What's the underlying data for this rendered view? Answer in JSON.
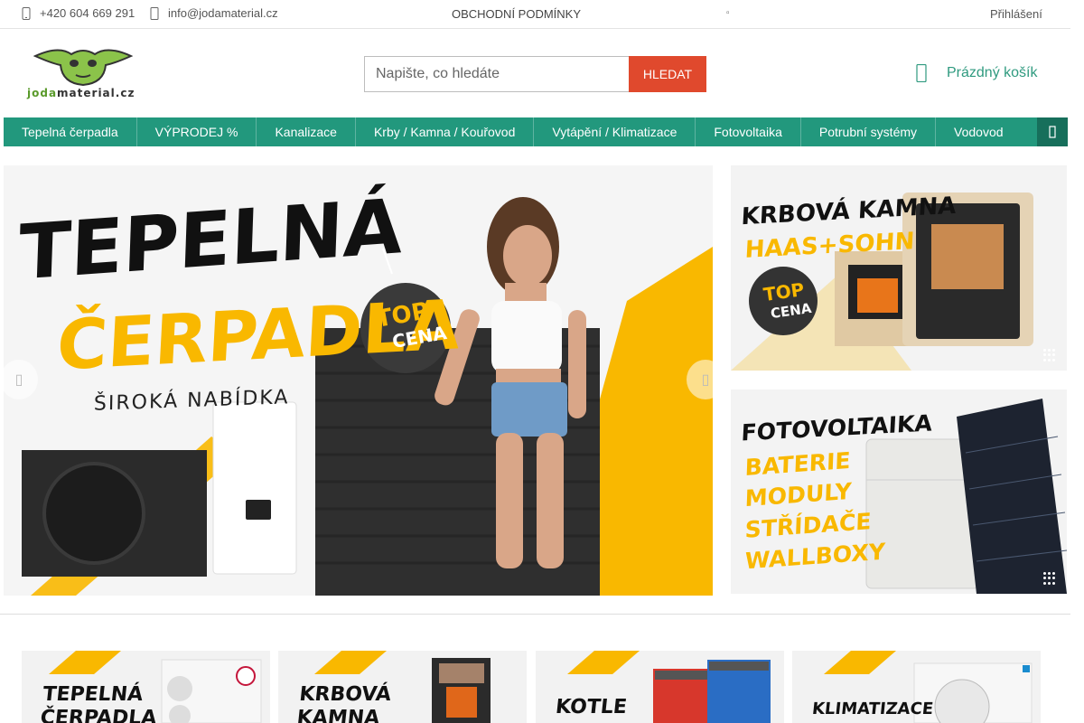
{
  "topbar": {
    "phone": "+420 604 669 291",
    "email": "info@jodamaterial.cz",
    "terms": "OBCHODNÍ PODMÍNKY",
    "login": "Přihlášení"
  },
  "logo": {
    "part1": "joda",
    "part2": "material.cz"
  },
  "search": {
    "placeholder": "Napište, co hledáte",
    "button": "HLEDAT"
  },
  "cart": {
    "label": "Prázdný košík"
  },
  "nav": {
    "items": [
      "Tepelná čerpadla",
      "VÝPRODEJ %",
      "Kanalizace",
      "Krby / Kamna / Kouřovod",
      "Vytápění / Klimatizace",
      "Fotovoltaika",
      "Potrubní systémy",
      "Vodovod"
    ]
  },
  "hero": {
    "title1": "TEPELNÁ",
    "title2": "ČERPADLA",
    "subtitle": "ŠIROKÁ NABÍDKA",
    "badge1": "TOP",
    "badge2": "CENA"
  },
  "banner1": {
    "line1": "KRBOVÁ KAMNA",
    "line2": "HAAS+SOHN",
    "badge1": "TOP",
    "badge2": "CENA"
  },
  "banner2": {
    "title": "FOTOVOLTAIKA",
    "l1": "BATERIE",
    "l2": "MODULY",
    "l3": "STŘÍDAČE",
    "l4": "WALLBOXY"
  },
  "categories": [
    {
      "label1": "TEPELNÁ",
      "label2": "ČERPADLA"
    },
    {
      "label1": "KRBOVÁ",
      "label2": "KAMNA"
    },
    {
      "label1": "KOTLE",
      "label2": ""
    },
    {
      "label1": "KLIMATIZACE",
      "label2": ""
    }
  ],
  "colors": {
    "accent": "#22987d",
    "search_button": "#e0492d",
    "highlight": "#f9b800"
  },
  "icons": {
    "phone": "phone-icon",
    "email": "email-icon",
    "cart": "cart-icon",
    "more": "chevron-right-icon",
    "prev": "chevron-left-icon",
    "next": "chevron-right-icon"
  }
}
